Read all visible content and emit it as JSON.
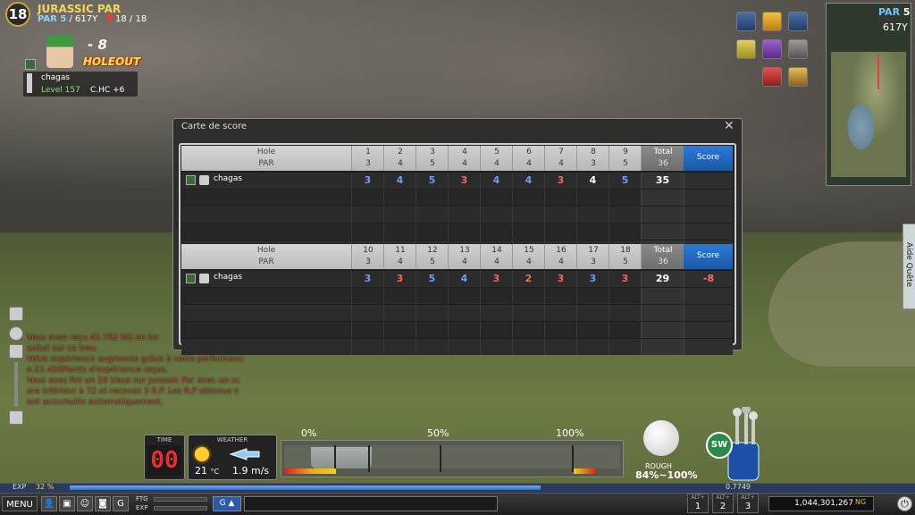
{
  "hole": {
    "number": "18",
    "name": "JURASSIC PAR",
    "par_label": "PAR 5",
    "yardage": "617Y",
    "progress": "18 / 18"
  },
  "player": {
    "strokes": "- 8",
    "status": "HOLEOUT",
    "name": "chagas",
    "level_label": "Level",
    "level": "157",
    "hcp_label": "C.HC",
    "hcp": "+6"
  },
  "minimap": {
    "par_label": "PAR",
    "par": "5",
    "yardage": "617Y"
  },
  "side_tab": "Aide Quête",
  "scorecard": {
    "title": "Carte de score",
    "hole_label": "Hole",
    "par_label": "PAR",
    "total_label": "Total",
    "score_label": "Score",
    "front": {
      "holes": [
        "1",
        "2",
        "3",
        "4",
        "5",
        "6",
        "7",
        "8",
        "9"
      ],
      "pars": [
        "3",
        "4",
        "5",
        "4",
        "4",
        "4",
        "4",
        "3",
        "5"
      ],
      "par_total": "36",
      "player": "chagas",
      "strokes": [
        "3",
        "4",
        "5",
        "3",
        "4",
        "4",
        "3",
        "4",
        "5"
      ],
      "total": "35",
      "score": ""
    },
    "back": {
      "holes": [
        "10",
        "11",
        "12",
        "13",
        "14",
        "15",
        "16",
        "17",
        "18"
      ],
      "pars": [
        "3",
        "4",
        "5",
        "4",
        "4",
        "4",
        "4",
        "3",
        "5"
      ],
      "par_total": "36",
      "player": "chagas",
      "strokes": [
        "3",
        "3",
        "5",
        "4",
        "3",
        "2",
        "3",
        "3",
        "3"
      ],
      "total": "29",
      "score": "-8"
    }
  },
  "chat": [
    "Vous avez reçu 41.762 NG en bo",
    "sultat sur ce trou.",
    "Votre expérience augmente grâce à votre performanc",
    "e.11.450Points d'expérience reçus.",
    "Vous avez fini un 18 trous sur Jurassic Par avec un sc",
    "ore inférieur à 72 et recevez 3 R.P. Les R.P obtenus s",
    "ont accumulés automatiquement."
  ],
  "hud": {
    "time_label": "TIME",
    "time_value": "00",
    "weather_label": "WEATHER",
    "temp": "21",
    "temp_unit": "°C",
    "wind": "1.9 m/s",
    "power_labels": [
      "0%",
      "50%",
      "100%"
    ],
    "lie_label": "ROUGH",
    "lie_pct": "84%~100%",
    "club": "SW"
  },
  "exp": {
    "label": "EXP",
    "pct": "32 %",
    "value": "0.7749",
    "progress": 0.72
  },
  "bottom": {
    "menu_label": "MENU",
    "ftg_label": "FTG",
    "exp_label": "EXP",
    "chat_mode": "G",
    "alt_label": "ALT+",
    "alts": [
      "1",
      "2",
      "3"
    ],
    "ng_amount": "1,044,301,267",
    "ng_unit": "NG"
  },
  "colors": {
    "par": "#6b9cff",
    "birdie": "#ff6060",
    "score_blue": "#1f6ed0"
  }
}
